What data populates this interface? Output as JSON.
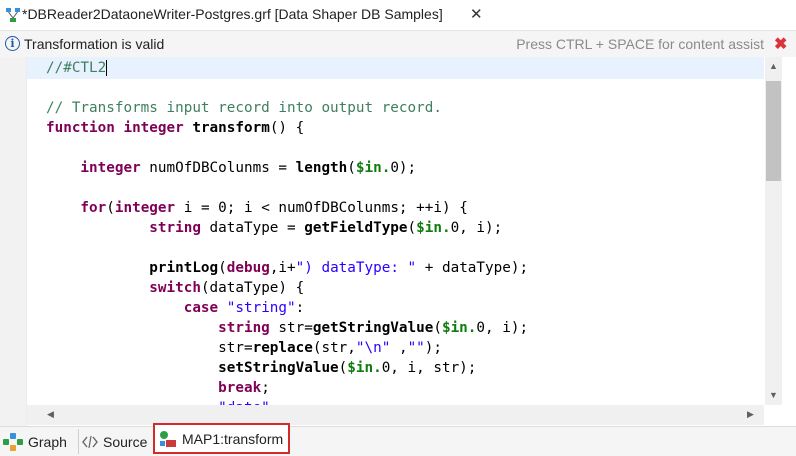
{
  "editor_tab": {
    "title": "*DBReader2DataoneWriter-Postgres.grf [Data Shaper DB Samples]",
    "close_symbol": "✕"
  },
  "infobar": {
    "status": "Transformation is valid",
    "hint": "Press CTRL + SPACE for content assist",
    "close_symbol": "✖"
  },
  "code_lines": [
    [
      {
        "t": "//#CTL2",
        "c": "cmt"
      }
    ],
    [],
    [
      {
        "t": "// Transforms input record into output record.",
        "c": "cmt"
      }
    ],
    [
      {
        "t": "function ",
        "c": "kw"
      },
      {
        "t": "integer ",
        "c": "kw"
      },
      {
        "t": "transform",
        "c": "fn"
      },
      {
        "t": "() {"
      }
    ],
    [],
    [
      {
        "t": "    integer ",
        "c": "kw"
      },
      {
        "t": "numOfDBColunms = "
      },
      {
        "t": "length",
        "c": "fn"
      },
      {
        "t": "("
      },
      {
        "t": "$in.",
        "c": "var"
      },
      {
        "t": "0);"
      }
    ],
    [],
    [
      {
        "t": "    for",
        "c": "kw"
      },
      {
        "t": "("
      },
      {
        "t": "integer ",
        "c": "kw"
      },
      {
        "t": "i = 0; i < numOfDBColunms; ++i) {"
      }
    ],
    [
      {
        "t": "            string ",
        "c": "kw"
      },
      {
        "t": "dataType = "
      },
      {
        "t": "getFieldType",
        "c": "fn"
      },
      {
        "t": "("
      },
      {
        "t": "$in.",
        "c": "var"
      },
      {
        "t": "0, i);"
      }
    ],
    [],
    [
      {
        "t": "            printLog",
        "c": "fn"
      },
      {
        "t": "("
      },
      {
        "t": "debug",
        "c": "kw"
      },
      {
        "t": ",i+"
      },
      {
        "t": "\") dataType: \"",
        "c": "str"
      },
      {
        "t": " + dataType);"
      }
    ],
    [
      {
        "t": "            switch",
        "c": "kw"
      },
      {
        "t": "(dataType) {"
      }
    ],
    [
      {
        "t": "                case ",
        "c": "kw"
      },
      {
        "t": "\"string\"",
        "c": "str"
      },
      {
        "t": ":"
      }
    ],
    [
      {
        "t": "                    string ",
        "c": "kw"
      },
      {
        "t": "str="
      },
      {
        "t": "getStringValue",
        "c": "fn"
      },
      {
        "t": "("
      },
      {
        "t": "$in.",
        "c": "var"
      },
      {
        "t": "0, i);"
      }
    ],
    [
      {
        "t": "                    str="
      },
      {
        "t": "replace",
        "c": "fn"
      },
      {
        "t": "(str,"
      },
      {
        "t": "\"\\n\" ",
        "c": "str"
      },
      {
        "t": ","
      },
      {
        "t": "\"\"",
        "c": "str"
      },
      {
        "t": ");"
      }
    ],
    [
      {
        "t": "                    setStringValue",
        "c": "fn"
      },
      {
        "t": "("
      },
      {
        "t": "$in.",
        "c": "var"
      },
      {
        "t": "0, i, str);"
      }
    ],
    [
      {
        "t": "                    break",
        "c": "kw"
      },
      {
        "t": ";"
      }
    ],
    [
      {
        "t": "                    \"date\"",
        "c": "str"
      }
    ]
  ],
  "bottom_tabs": [
    {
      "label": "Graph",
      "icon": "graph-icon"
    },
    {
      "label": "Source",
      "icon": "source-code-icon"
    },
    {
      "label": "MAP1:transform",
      "icon": "map-transform-icon",
      "active": true
    }
  ],
  "colors": {
    "keyword": "#7f0055",
    "string": "#2a00ff",
    "comment": "#3f7f5f",
    "variable": "#0e7c0e",
    "active_tab_highlight": "#d22b2b"
  }
}
